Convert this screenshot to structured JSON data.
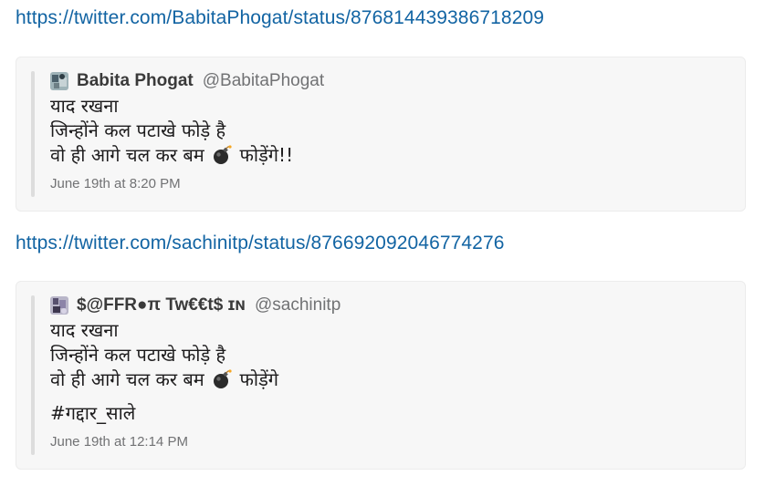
{
  "messages": [
    {
      "link": "https://twitter.com/BabitaPhogat/status/876814439386718209",
      "author_name": "Babita Phogat",
      "author_handle": "@BabitaPhogat",
      "lines": [
        "याद रखना",
        "जिन्होंने कल पटाखे फोड़े है",
        "वो ही आगे चल कर बम",
        "फोड़ेंगे!!"
      ],
      "timestamp": "June 19th at 8:20 PM"
    },
    {
      "link": "https://twitter.com/sachinitp/status/876692092046774276",
      "author_name": "$@FFR●π Tw€€t$ ɪɴ",
      "author_handle": "@sachinitp",
      "lines": [
        "याद रखना",
        "जिन्होंने कल पटाखे फोड़े है",
        "वो ही आगे चल कर बम",
        "फोड़ेंगे"
      ],
      "hashtag": "#गद्दार_साले",
      "timestamp": "June 19th at 12:14 PM"
    }
  ],
  "icons": {
    "bomb": "bomb-emoji",
    "avatar": "avatar"
  },
  "colors": {
    "link": "#1264a3",
    "card_bg": "#f7f7f7",
    "quote_bar": "#dddddd",
    "muted": "#717274"
  }
}
